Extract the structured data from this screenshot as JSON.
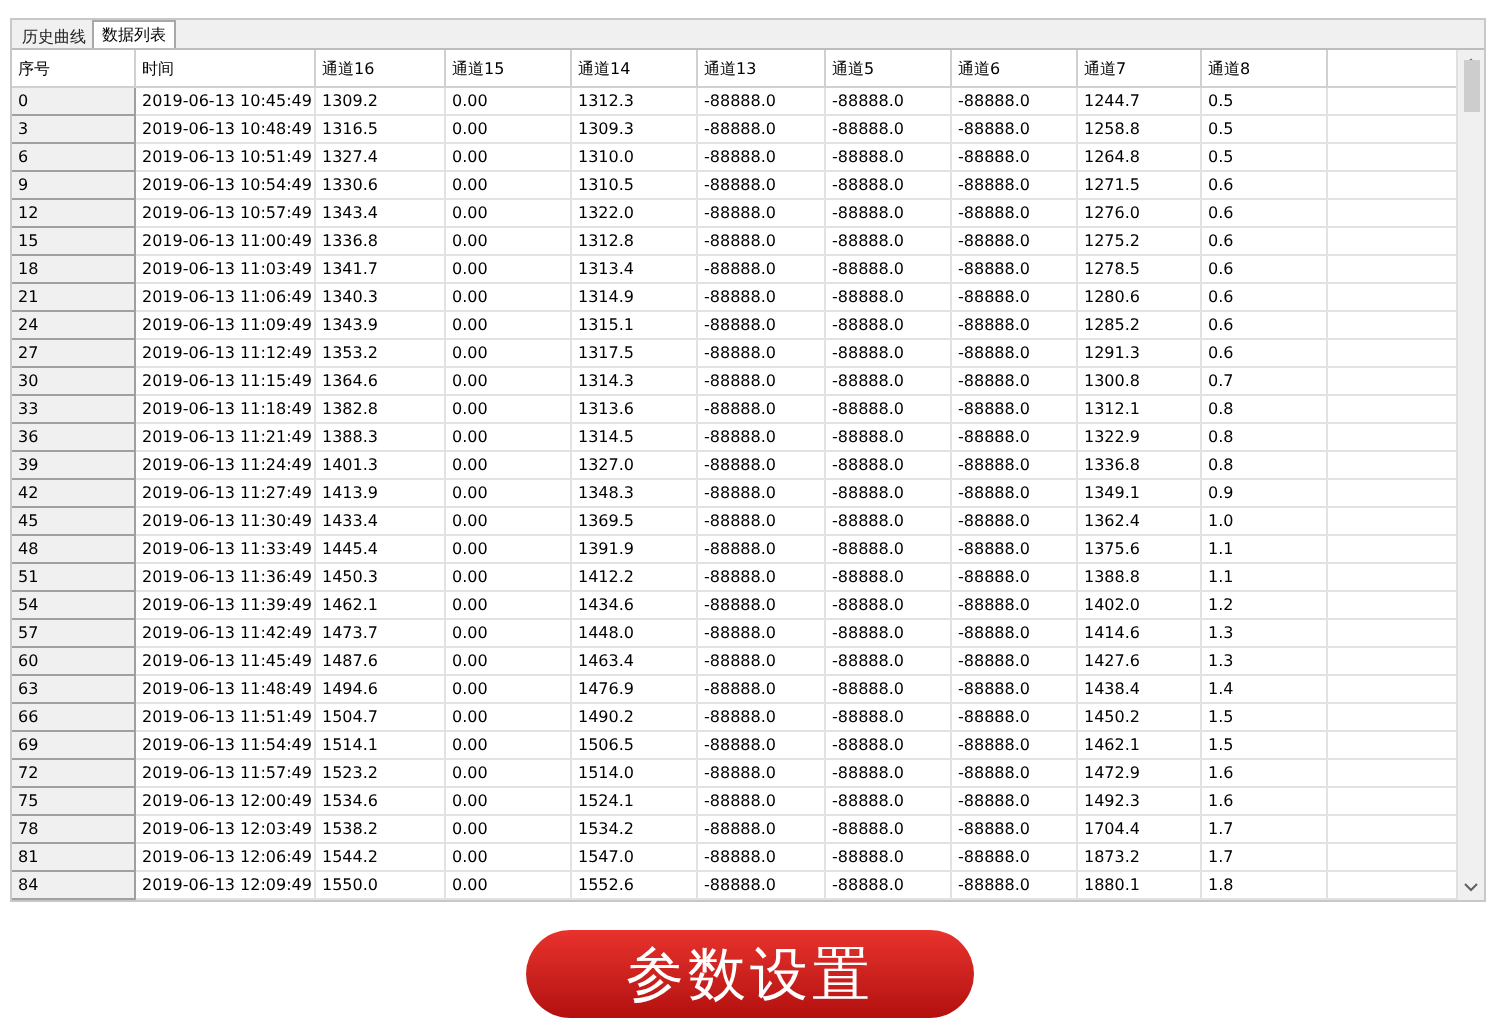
{
  "tabs": [
    {
      "label": "历史曲线",
      "selected": false
    },
    {
      "label": "数据列表",
      "selected": true
    }
  ],
  "table": {
    "columns": [
      "序号",
      "时间",
      "通道16",
      "通道15",
      "通道14",
      "通道13",
      "通道5",
      "通道6",
      "通道7",
      "通道8"
    ],
    "rows": [
      [
        "0",
        "2019-06-13 10:45:49",
        "1309.2",
        "0.00",
        "1312.3",
        "-88888.0",
        "-88888.0",
        "-88888.0",
        "1244.7",
        "0.5"
      ],
      [
        "3",
        "2019-06-13 10:48:49",
        "1316.5",
        "0.00",
        "1309.3",
        "-88888.0",
        "-88888.0",
        "-88888.0",
        "1258.8",
        "0.5"
      ],
      [
        "6",
        "2019-06-13 10:51:49",
        "1327.4",
        "0.00",
        "1310.0",
        "-88888.0",
        "-88888.0",
        "-88888.0",
        "1264.8",
        "0.5"
      ],
      [
        "9",
        "2019-06-13 10:54:49",
        "1330.6",
        "0.00",
        "1310.5",
        "-88888.0",
        "-88888.0",
        "-88888.0",
        "1271.5",
        "0.6"
      ],
      [
        "12",
        "2019-06-13 10:57:49",
        "1343.4",
        "0.00",
        "1322.0",
        "-88888.0",
        "-88888.0",
        "-88888.0",
        "1276.0",
        "0.6"
      ],
      [
        "15",
        "2019-06-13 11:00:49",
        "1336.8",
        "0.00",
        "1312.8",
        "-88888.0",
        "-88888.0",
        "-88888.0",
        "1275.2",
        "0.6"
      ],
      [
        "18",
        "2019-06-13 11:03:49",
        "1341.7",
        "0.00",
        "1313.4",
        "-88888.0",
        "-88888.0",
        "-88888.0",
        "1278.5",
        "0.6"
      ],
      [
        "21",
        "2019-06-13 11:06:49",
        "1340.3",
        "0.00",
        "1314.9",
        "-88888.0",
        "-88888.0",
        "-88888.0",
        "1280.6",
        "0.6"
      ],
      [
        "24",
        "2019-06-13 11:09:49",
        "1343.9",
        "0.00",
        "1315.1",
        "-88888.0",
        "-88888.0",
        "-88888.0",
        "1285.2",
        "0.6"
      ],
      [
        "27",
        "2019-06-13 11:12:49",
        "1353.2",
        "0.00",
        "1317.5",
        "-88888.0",
        "-88888.0",
        "-88888.0",
        "1291.3",
        "0.6"
      ],
      [
        "30",
        "2019-06-13 11:15:49",
        "1364.6",
        "0.00",
        "1314.3",
        "-88888.0",
        "-88888.0",
        "-88888.0",
        "1300.8",
        "0.7"
      ],
      [
        "33",
        "2019-06-13 11:18:49",
        "1382.8",
        "0.00",
        "1313.6",
        "-88888.0",
        "-88888.0",
        "-88888.0",
        "1312.1",
        "0.8"
      ],
      [
        "36",
        "2019-06-13 11:21:49",
        "1388.3",
        "0.00",
        "1314.5",
        "-88888.0",
        "-88888.0",
        "-88888.0",
        "1322.9",
        "0.8"
      ],
      [
        "39",
        "2019-06-13 11:24:49",
        "1401.3",
        "0.00",
        "1327.0",
        "-88888.0",
        "-88888.0",
        "-88888.0",
        "1336.8",
        "0.8"
      ],
      [
        "42",
        "2019-06-13 11:27:49",
        "1413.9",
        "0.00",
        "1348.3",
        "-88888.0",
        "-88888.0",
        "-88888.0",
        "1349.1",
        "0.9"
      ],
      [
        "45",
        "2019-06-13 11:30:49",
        "1433.4",
        "0.00",
        "1369.5",
        "-88888.0",
        "-88888.0",
        "-88888.0",
        "1362.4",
        "1.0"
      ],
      [
        "48",
        "2019-06-13 11:33:49",
        "1445.4",
        "0.00",
        "1391.9",
        "-88888.0",
        "-88888.0",
        "-88888.0",
        "1375.6",
        "1.1"
      ],
      [
        "51",
        "2019-06-13 11:36:49",
        "1450.3",
        "0.00",
        "1412.2",
        "-88888.0",
        "-88888.0",
        "-88888.0",
        "1388.8",
        "1.1"
      ],
      [
        "54",
        "2019-06-13 11:39:49",
        "1462.1",
        "0.00",
        "1434.6",
        "-88888.0",
        "-88888.0",
        "-88888.0",
        "1402.0",
        "1.2"
      ],
      [
        "57",
        "2019-06-13 11:42:49",
        "1473.7",
        "0.00",
        "1448.0",
        "-88888.0",
        "-88888.0",
        "-88888.0",
        "1414.6",
        "1.3"
      ],
      [
        "60",
        "2019-06-13 11:45:49",
        "1487.6",
        "0.00",
        "1463.4",
        "-88888.0",
        "-88888.0",
        "-88888.0",
        "1427.6",
        "1.3"
      ],
      [
        "63",
        "2019-06-13 11:48:49",
        "1494.6",
        "0.00",
        "1476.9",
        "-88888.0",
        "-88888.0",
        "-88888.0",
        "1438.4",
        "1.4"
      ],
      [
        "66",
        "2019-06-13 11:51:49",
        "1504.7",
        "0.00",
        "1490.2",
        "-88888.0",
        "-88888.0",
        "-88888.0",
        "1450.2",
        "1.5"
      ],
      [
        "69",
        "2019-06-13 11:54:49",
        "1514.1",
        "0.00",
        "1506.5",
        "-88888.0",
        "-88888.0",
        "-88888.0",
        "1462.1",
        "1.5"
      ],
      [
        "72",
        "2019-06-13 11:57:49",
        "1523.2",
        "0.00",
        "1514.0",
        "-88888.0",
        "-88888.0",
        "-88888.0",
        "1472.9",
        "1.6"
      ],
      [
        "75",
        "2019-06-13 12:00:49",
        "1534.6",
        "0.00",
        "1524.1",
        "-88888.0",
        "-88888.0",
        "-88888.0",
        "1492.3",
        "1.6"
      ],
      [
        "78",
        "2019-06-13 12:03:49",
        "1538.2",
        "0.00",
        "1534.2",
        "-88888.0",
        "-88888.0",
        "-88888.0",
        "1704.4",
        "1.7"
      ],
      [
        "81",
        "2019-06-13 12:06:49",
        "1544.2",
        "0.00",
        "1547.0",
        "-88888.0",
        "-88888.0",
        "-88888.0",
        "1873.2",
        "1.7"
      ],
      [
        "84",
        "2019-06-13 12:09:49",
        "1550.0",
        "0.00",
        "1552.6",
        "-88888.0",
        "-88888.0",
        "-88888.0",
        "1880.1",
        "1.8"
      ]
    ]
  },
  "button": {
    "label": "参数设置"
  }
}
